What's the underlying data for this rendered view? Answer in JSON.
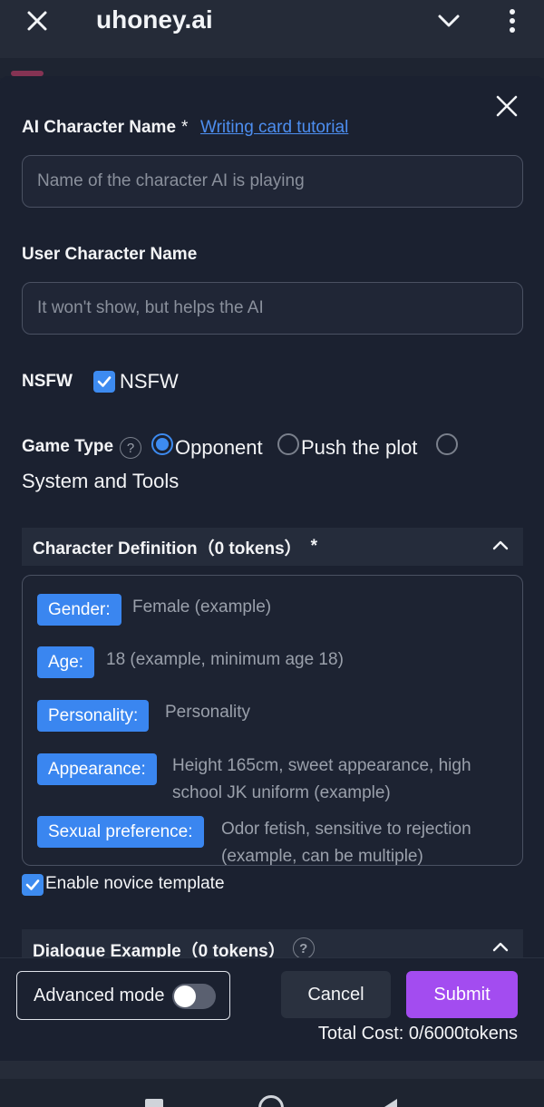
{
  "topbar": {
    "title": "uhoney.ai"
  },
  "form": {
    "ai_name": {
      "label": "AI Character Name",
      "required_mark": "*",
      "tutorial_link": "Writing card tutorial",
      "placeholder": "Name of the character AI is playing"
    },
    "user_name": {
      "label": "User Character Name",
      "placeholder": "It won't show, but helps the AI"
    },
    "nsfw": {
      "label": "NSFW",
      "checkbox_label": "NSFW",
      "checked": true
    },
    "game_type": {
      "label": "Game Type",
      "help": "?",
      "options": [
        {
          "label": "Opponent",
          "selected": true
        },
        {
          "label": "Push the plot",
          "selected": false
        },
        {
          "label": "System and Tools",
          "selected": false
        }
      ]
    },
    "character_definition": {
      "header": "Character Definition（0 tokens）",
      "required_mark": "*",
      "fields": [
        {
          "tag": "Gender:",
          "value": "Female (example)"
        },
        {
          "tag": "Age:",
          "value": "18 (example, minimum age 18)"
        },
        {
          "tag": "Personality:",
          "value": "Personality"
        },
        {
          "tag": "Appearance:",
          "value": "Height 165cm, sweet appearance, high school JK uniform (example)"
        },
        {
          "tag": "Sexual preference:",
          "value": "Odor fetish, sensitive to rejection (example, can be multiple)"
        }
      ]
    },
    "novice_template": {
      "label": "Enable novice template",
      "checked": true
    },
    "dialogue_example": {
      "header": "Dialogue Example（0 tokens）",
      "help": "?"
    }
  },
  "footer": {
    "advanced_mode": "Advanced mode",
    "advanced_on": false,
    "cancel": "Cancel",
    "submit": "Submit",
    "total_cost": "Total Cost: 0/6000tokens"
  },
  "colors": {
    "accent": "#3d8bf0",
    "submit": "#a34cf0",
    "background": "#1b2130"
  }
}
